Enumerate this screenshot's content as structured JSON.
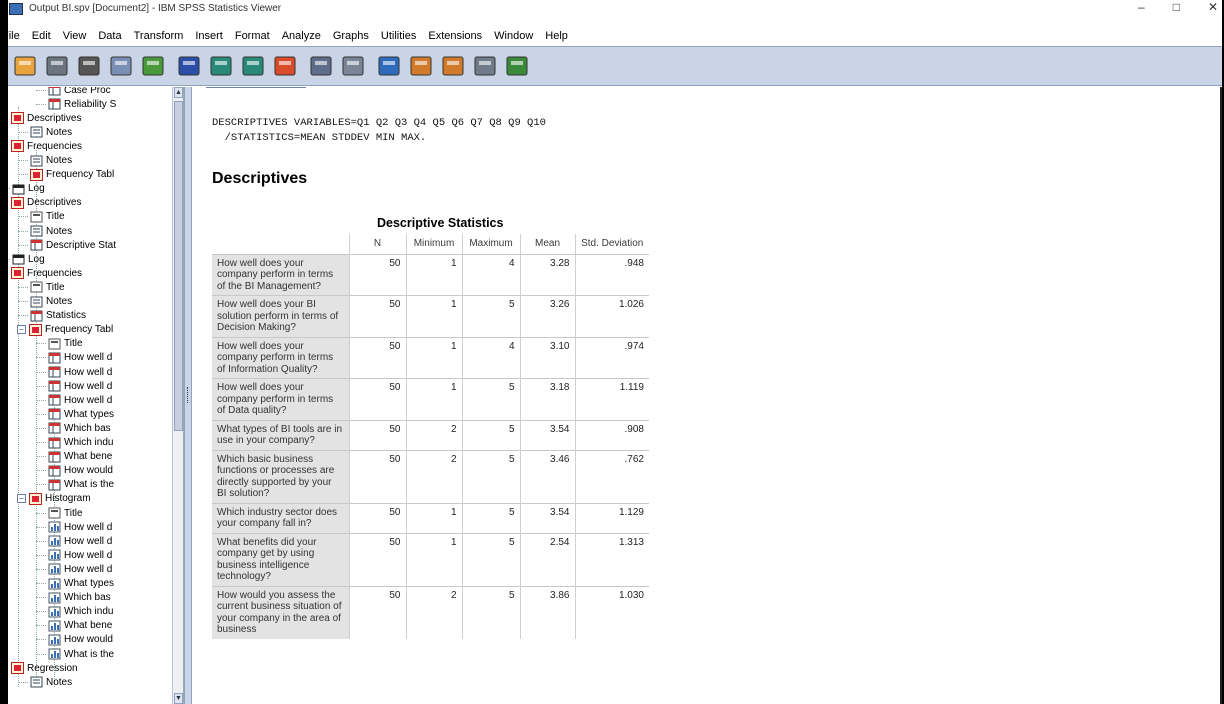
{
  "window": {
    "title": "Output BI.spv [Document2] - IBM SPSS Statistics Viewer",
    "min": "–",
    "max": "□",
    "close": "✕"
  },
  "menu": [
    "File",
    "Edit",
    "View",
    "Data",
    "Transform",
    "Insert",
    "Format",
    "Analyze",
    "Graphs",
    "Utilities",
    "Extensions",
    "Window",
    "Help"
  ],
  "toolbar_icons": [
    "open-folder-icon",
    "save-icon",
    "print-icon",
    "print-preview-icon",
    "export-icon",
    "recall-dialog-icon",
    "undo-icon",
    "redo-icon",
    "goto-case-icon",
    "goto-variable-icon",
    "variables-icon",
    "insert-table-icon",
    "designate-window-icon",
    "run-script-icon",
    "hide-icon",
    "show-icon"
  ],
  "tree": [
    {
      "label": "Case Proc",
      "icon": "table-icon",
      "level": 3
    },
    {
      "label": "Reliability S",
      "icon": "table-icon",
      "level": 3
    },
    {
      "label": "Descriptives",
      "icon": "proc-icon",
      "level": 1,
      "exp": "−"
    },
    {
      "label": "Notes",
      "icon": "notes-icon",
      "level": 2
    },
    {
      "label": "Frequencies",
      "icon": "proc-icon",
      "level": 1,
      "exp": "−"
    },
    {
      "label": "Notes",
      "icon": "notes-icon",
      "level": 2
    },
    {
      "label": "Frequency Tabl",
      "icon": "proc-icon",
      "level": 2
    },
    {
      "label": "Log",
      "icon": "log-icon",
      "level": 1
    },
    {
      "label": "Descriptives",
      "icon": "proc-icon",
      "level": 1,
      "exp": "−"
    },
    {
      "label": "Title",
      "icon": "title-icon",
      "level": 2
    },
    {
      "label": "Notes",
      "icon": "notes-icon",
      "level": 2
    },
    {
      "label": "Descriptive Stat",
      "icon": "table-icon",
      "level": 2
    },
    {
      "label": "Log",
      "icon": "log-icon",
      "level": 1
    },
    {
      "label": "Frequencies",
      "icon": "proc-icon",
      "level": 1,
      "exp": "−"
    },
    {
      "label": "Title",
      "icon": "title-icon",
      "level": 2
    },
    {
      "label": "Notes",
      "icon": "notes-icon",
      "level": 2
    },
    {
      "label": "Statistics",
      "icon": "table-icon",
      "level": 2
    },
    {
      "label": "Frequency Tabl",
      "icon": "proc-icon",
      "level": 2,
      "exp": "−"
    },
    {
      "label": "Title",
      "icon": "title-icon",
      "level": 3
    },
    {
      "label": "How well d",
      "icon": "table-icon",
      "level": 3
    },
    {
      "label": "How well d",
      "icon": "table-icon",
      "level": 3
    },
    {
      "label": "How well d",
      "icon": "table-icon",
      "level": 3
    },
    {
      "label": "How well d",
      "icon": "table-icon",
      "level": 3
    },
    {
      "label": "What types",
      "icon": "table-icon",
      "level": 3
    },
    {
      "label": "Which bas",
      "icon": "table-icon",
      "level": 3
    },
    {
      "label": "Which indu",
      "icon": "table-icon",
      "level": 3
    },
    {
      "label": "What bene",
      "icon": "table-icon",
      "level": 3
    },
    {
      "label": "How would",
      "icon": "table-icon",
      "level": 3
    },
    {
      "label": "What is the",
      "icon": "table-icon",
      "level": 3
    },
    {
      "label": "Histogram",
      "icon": "proc-icon",
      "level": 2,
      "exp": "−"
    },
    {
      "label": "Title",
      "icon": "title-icon",
      "level": 3
    },
    {
      "label": "How well d",
      "icon": "chart-icon",
      "level": 3
    },
    {
      "label": "How well d",
      "icon": "chart-icon",
      "level": 3
    },
    {
      "label": "How well d",
      "icon": "chart-icon",
      "level": 3
    },
    {
      "label": "How well d",
      "icon": "chart-icon",
      "level": 3
    },
    {
      "label": "What types",
      "icon": "chart-icon",
      "level": 3
    },
    {
      "label": "Which bas",
      "icon": "chart-icon",
      "level": 3
    },
    {
      "label": "Which indu",
      "icon": "chart-icon",
      "level": 3
    },
    {
      "label": "What bene",
      "icon": "chart-icon",
      "level": 3
    },
    {
      "label": "How would",
      "icon": "chart-icon",
      "level": 3
    },
    {
      "label": "What is the",
      "icon": "chart-icon",
      "level": 3
    },
    {
      "label": "Regression",
      "icon": "proc-icon",
      "level": 1,
      "exp": "−"
    },
    {
      "label": "Notes",
      "icon": "notes-icon",
      "level": 2
    }
  ],
  "syntax": "DESCRIPTIVES VARIABLES=Q1 Q2 Q3 Q4 Q5 Q6 Q7 Q8 Q9 Q10\n  /STATISTICS=MEAN STDDEV MIN MAX.",
  "heading": "Descriptives",
  "table": {
    "title": "Descriptive Statistics",
    "columns": [
      "",
      "N",
      "Minimum",
      "Maximum",
      "Mean",
      "Std. Deviation"
    ],
    "rows": [
      {
        "label": "How well does your company perform in terms of the BI Management?",
        "n": "50",
        "min": "1",
        "max": "4",
        "mean": "3.28",
        "sd": ".948"
      },
      {
        "label": "How well does your BI solution perform in terms of Decision Making?",
        "n": "50",
        "min": "1",
        "max": "5",
        "mean": "3.26",
        "sd": "1.026"
      },
      {
        "label": "How well does your company perform in terms of Information Quality?",
        "n": "50",
        "min": "1",
        "max": "4",
        "mean": "3.10",
        "sd": ".974"
      },
      {
        "label": "How well does your company perform in terms of Data quality?",
        "n": "50",
        "min": "1",
        "max": "5",
        "mean": "3.18",
        "sd": "1.119"
      },
      {
        "label": "What types of BI tools are in use in your company?",
        "n": "50",
        "min": "2",
        "max": "5",
        "mean": "3.54",
        "sd": ".908"
      },
      {
        "label": "Which basic business functions or processes are directly supported by your BI solution?",
        "n": "50",
        "min": "2",
        "max": "5",
        "mean": "3.46",
        "sd": ".762"
      },
      {
        "label": "Which industry sector does your company fall in?",
        "n": "50",
        "min": "1",
        "max": "5",
        "mean": "3.54",
        "sd": "1.129"
      },
      {
        "label": "What benefits did your company get by using business intelligence technology?",
        "n": "50",
        "min": "1",
        "max": "5",
        "mean": "2.54",
        "sd": "1.313"
      },
      {
        "label": "How would you assess the current business situation of your company in the area of business",
        "n": "50",
        "min": "2",
        "max": "5",
        "mean": "3.86",
        "sd": "1.030"
      }
    ]
  }
}
